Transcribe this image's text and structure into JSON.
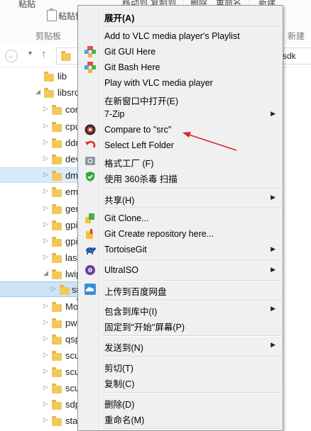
{
  "ribbon": {
    "paste_label": "粘贴",
    "paste_shortcut_label": "粘贴快",
    "clipboard_group": "剪贴板",
    "move_to_label": "移动到",
    "copy_to_label": "复制到",
    "delete_label": "删除",
    "rename_label": "重命名",
    "new_label": "新建",
    "new_group": "新建"
  },
  "address_bar": {
    "path_tail": "sdk"
  },
  "tree": [
    {
      "label": "lib"
    },
    {
      "label": "libsrc"
    },
    {
      "label": "cor"
    },
    {
      "label": "cpu"
    },
    {
      "label": "ddr"
    },
    {
      "label": "dev"
    },
    {
      "label": "dm"
    },
    {
      "label": "em"
    },
    {
      "label": "ger"
    },
    {
      "label": "gpi"
    },
    {
      "label": "gpi"
    },
    {
      "label": "lase"
    },
    {
      "label": "lwip"
    },
    {
      "label": "src"
    },
    {
      "label": "Mo"
    },
    {
      "label": "pwi"
    },
    {
      "label": "qsp"
    },
    {
      "label": "scu"
    },
    {
      "label": "scu"
    },
    {
      "label": "scu"
    },
    {
      "label": "sdp"
    },
    {
      "label": "star"
    }
  ],
  "context_menu": {
    "items": [
      {
        "label": "展开(A)",
        "bold": true
      },
      {
        "label": "Add to VLC media player's Playlist"
      },
      {
        "label": "Git GUI Here",
        "icon": "git-gui-icon"
      },
      {
        "label": "Git Bash Here",
        "icon": "git-bash-icon"
      },
      {
        "label": "Play with VLC media player"
      },
      {
        "label": "在新窗口中打开(E)"
      },
      {
        "label": "7-Zip",
        "submenu": true
      },
      {
        "label": "Compare to \"src\"",
        "icon": "compare-icon"
      },
      {
        "label": "Select Left Folder",
        "icon": "select-left-icon"
      },
      {
        "label": "格式工厂 (F)",
        "icon": "format-factory-icon"
      },
      {
        "label": "使用 360杀毒 扫描",
        "icon": "shield-360-icon"
      },
      {
        "label": "共享(H)",
        "submenu": true
      },
      {
        "label": "Git Clone...",
        "icon": "git-clone-icon"
      },
      {
        "label": "Git Create repository here...",
        "icon": "git-create-repo-icon"
      },
      {
        "label": "TortoiseGit",
        "icon": "tortoisegit-icon",
        "submenu": true
      },
      {
        "label": "UltraISO",
        "icon": "ultraiso-icon",
        "submenu": true
      },
      {
        "label": "上传到百度网盘",
        "icon": "baidu-cloud-icon"
      },
      {
        "label": "包含到库中(I)",
        "submenu": true
      },
      {
        "label": "固定到\"开始\"屏幕(P)"
      },
      {
        "label": "发送到(N)",
        "submenu": true
      },
      {
        "label": "剪切(T)"
      },
      {
        "label": "复制(C)"
      },
      {
        "label": "删除(D)"
      },
      {
        "label": "重命名(M)"
      }
    ]
  },
  "colors": {
    "menu_bg": "#f0f0f0",
    "selection": "#cce4f7",
    "annotation_arrow": "#d9262c",
    "folder": "#f2c85b"
  }
}
